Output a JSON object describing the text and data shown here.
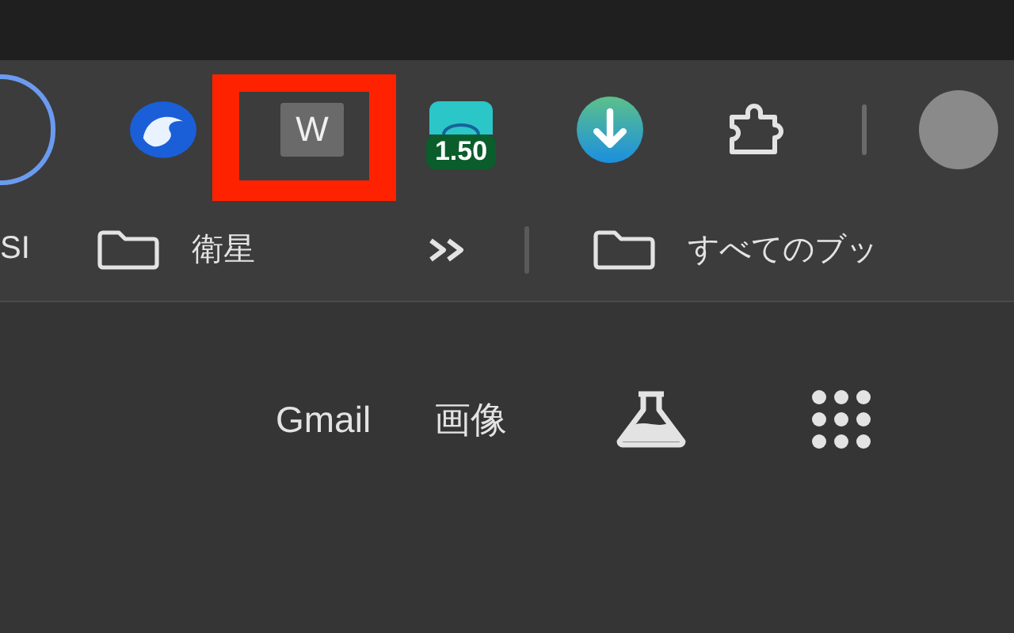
{
  "toolbar": {
    "extensions": [
      {
        "kind": "wave",
        "highlighted": false
      },
      {
        "kind": "letter",
        "label": "W",
        "highlighted": true
      },
      {
        "kind": "screen",
        "badge": "1.50",
        "highlighted": false
      },
      {
        "kind": "download",
        "highlighted": false
      },
      {
        "kind": "puzzle",
        "highlighted": false
      }
    ]
  },
  "bookmarks": [
    {
      "kind": "link",
      "label": "SI"
    },
    {
      "kind": "folder",
      "label": "衛星"
    },
    {
      "kind": "overflow"
    },
    {
      "kind": "separator"
    },
    {
      "kind": "folder",
      "label": "すべてのブッ"
    }
  ],
  "page": {
    "links": [
      "Gmail",
      "画像"
    ]
  }
}
